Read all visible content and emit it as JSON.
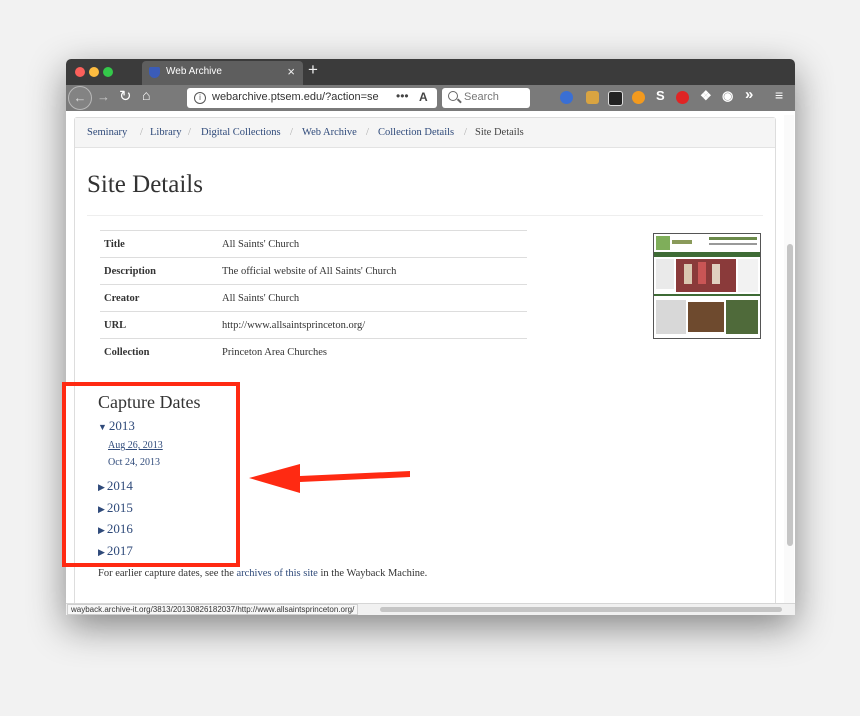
{
  "browser": {
    "tab_title": "Web Archive",
    "tab_close": "×",
    "new_tab": "+",
    "url": "webarchive.ptsem.edu/?action=se",
    "url_more": "•••",
    "search_placeholder": "Search",
    "icons": [
      "back-icon",
      "forward-icon",
      "reload-icon",
      "home-icon",
      "info-icon",
      "reader-mode-icon",
      "search-icon",
      "pocket-icon",
      "notes-icon",
      "screenshot-icon",
      "coupon-icon",
      "s-icon",
      "adblock-icon",
      "puzzle-icon",
      "account-icon",
      "overflow-icon",
      "menu-icon"
    ]
  },
  "breadcrumb": {
    "items": [
      "Seminary",
      "Library",
      "Digital Collections",
      "Web Archive",
      "Collection Details"
    ],
    "current": "Site Details",
    "separator": "/"
  },
  "page": {
    "title": "Site Details"
  },
  "details": {
    "rows": [
      {
        "label": "Title",
        "value": "All Saints' Church"
      },
      {
        "label": "Description",
        "value": "The official website of All Saints' Church"
      },
      {
        "label": "Creator",
        "value": "All Saints' Church"
      },
      {
        "label": "URL",
        "value": "http://www.allsaintsprinceton.org/"
      },
      {
        "label": "Collection",
        "value": "Princeton Area Churches"
      }
    ]
  },
  "capture": {
    "heading": "Capture Dates",
    "years": [
      {
        "label": "2013",
        "expanded": true,
        "dates": [
          "Aug 26, 2013",
          "Oct 24, 2013"
        ]
      },
      {
        "label": "2014",
        "expanded": false
      },
      {
        "label": "2015",
        "expanded": false
      },
      {
        "label": "2016",
        "expanded": false
      },
      {
        "label": "2017",
        "expanded": false
      }
    ],
    "note_before": "For earlier capture dates, see the",
    "note_link": "archives of this site",
    "note_after": "in the Wayback Machine."
  },
  "status_url": "wayback.archive-it.org/3813/20130826182037/http://www.allsaintsprinceton.org/",
  "colors": {
    "link": "#2f4a7a",
    "highlight": "#ff2a12",
    "tabbar": "#3b3b3b",
    "toolbar": "#7a7a7a"
  }
}
